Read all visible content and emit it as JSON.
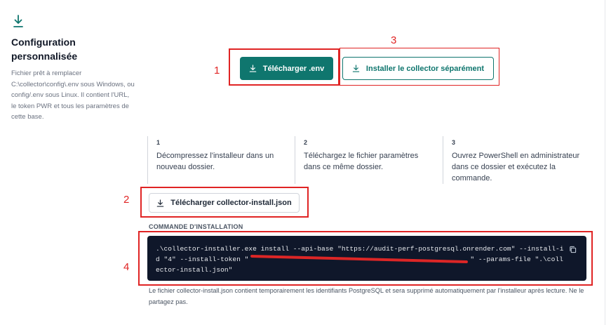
{
  "sidebar": {
    "title": "Configuration personnalisée",
    "description": "Fichier prêt à remplacer C:\\collector\\config\\.env sous Windows, ou config/.env sous Linux. Il contient l'URL, le token PWR et tous les paramètres de cette base.",
    "icon": "download-icon"
  },
  "actions": {
    "download_env_label": "Télécharger .env",
    "install_separately_label": "Installer le collector séparément",
    "download_json_label": "Télécharger collector-install.json"
  },
  "steps": [
    {
      "num": "1",
      "text": "Décompressez l'installeur dans un nouveau dossier."
    },
    {
      "num": "2",
      "text": "Téléchargez le fichier paramètres dans ce même dossier."
    },
    {
      "num": "3",
      "text": "Ouvrez PowerShell en administrateur dans ce dossier et exécutez la commande."
    }
  ],
  "install": {
    "label": "COMMANDE D'INSTALLATION",
    "command_before": ".\\collector-installer.exe install --api-base \"https://audit-perf-postgresql.onrender.com\" --install-id \"4\" --install-token \"",
    "command_after": "\" --params-file \".\\collector-install.json\"",
    "note": "Le fichier collector-install.json contient temporairement les identifiants PostgreSQL et sera supprimé automatiquement par l'installeur après lecture. Ne le partagez pas."
  },
  "annotations": [
    "1",
    "2",
    "3",
    "4"
  ],
  "colors": {
    "primary": "#0f766e",
    "annotation": "#e02424",
    "code_bg": "#0f172a"
  }
}
